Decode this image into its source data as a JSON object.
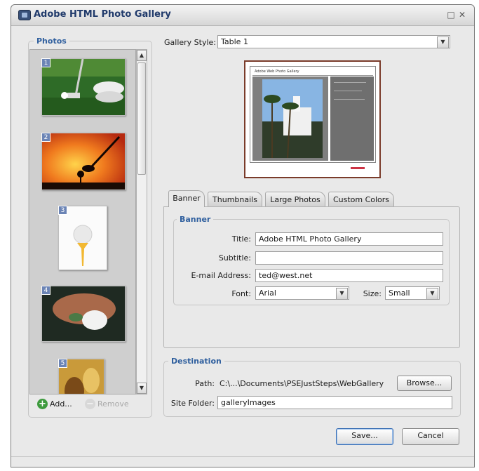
{
  "window": {
    "title": "Adobe HTML Photo Gallery"
  },
  "photos": {
    "legend": "Photos",
    "items": [
      {
        "number": "1"
      },
      {
        "number": "2"
      },
      {
        "number": "3"
      },
      {
        "number": "4"
      },
      {
        "number": "5"
      }
    ],
    "add_label": "Add...",
    "remove_label": "Remove"
  },
  "gallery_style": {
    "label": "Gallery Style:",
    "value": "Table 1"
  },
  "preview": {
    "header_text": "Adobe Web Photo Gallery"
  },
  "tabs": [
    {
      "label": "Banner",
      "active": true
    },
    {
      "label": "Thumbnails",
      "active": false
    },
    {
      "label": "Large Photos",
      "active": false
    },
    {
      "label": "Custom Colors",
      "active": false
    }
  ],
  "banner": {
    "legend": "Banner",
    "title_label": "Title:",
    "title_value": "Adobe HTML Photo Gallery",
    "subtitle_label": "Subtitle:",
    "subtitle_value": "",
    "email_label": "E-mail Address:",
    "email_value": "ted@west.net",
    "font_label": "Font:",
    "font_value": "Arial",
    "size_label": "Size:",
    "size_value": "Small"
  },
  "destination": {
    "legend": "Destination",
    "path_label": "Path:",
    "path_value": "C:\\...\\Documents\\PSEJustSteps\\WebGallery",
    "browse_label": "Browse...",
    "site_folder_label": "Site Folder:",
    "site_folder_value": "galleryImages"
  },
  "footer": {
    "save_label": "Save...",
    "cancel_label": "Cancel"
  }
}
